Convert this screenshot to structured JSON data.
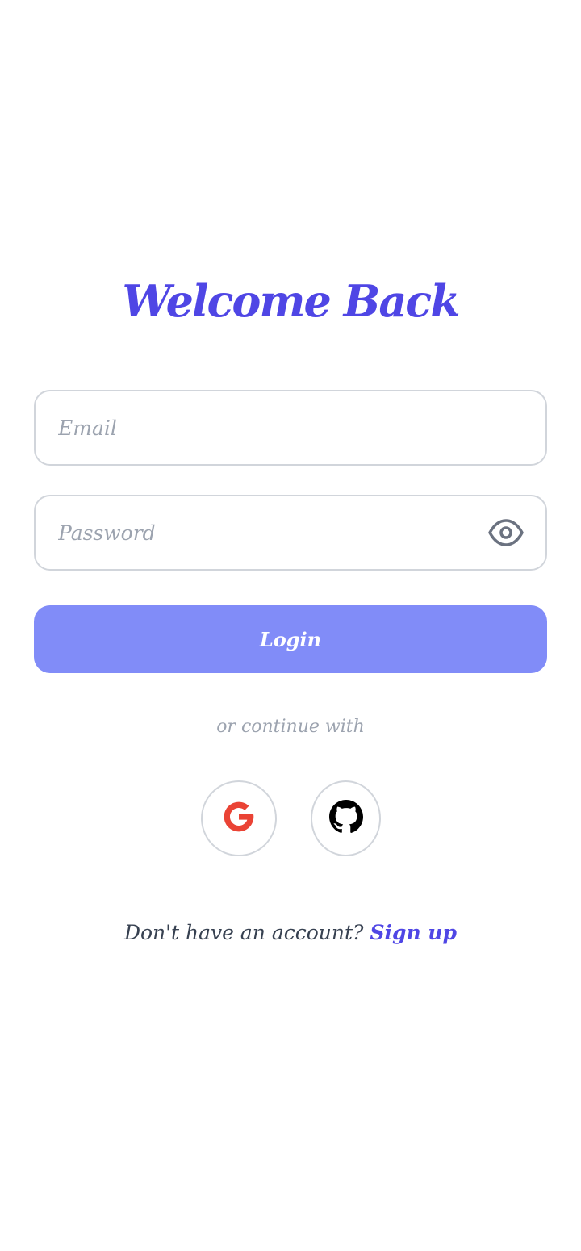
{
  "header": {
    "title": "Welcome Back"
  },
  "form": {
    "email_placeholder": "Email",
    "email_value": "",
    "password_placeholder": "Password",
    "password_value": "",
    "login_label": "Login"
  },
  "divider": {
    "text": "or continue with"
  },
  "social": {
    "providers": [
      {
        "name": "Google",
        "icon": "google-icon"
      },
      {
        "name": "GitHub",
        "icon": "github-icon"
      }
    ]
  },
  "footer": {
    "prompt": "Don't have an account?",
    "signup_label": "Sign up"
  },
  "colors": {
    "accent": "#4f46e5",
    "button": "#818cf8",
    "border": "#d1d5db",
    "muted_text": "#9ca3af",
    "icon_gray": "#6b7280"
  }
}
